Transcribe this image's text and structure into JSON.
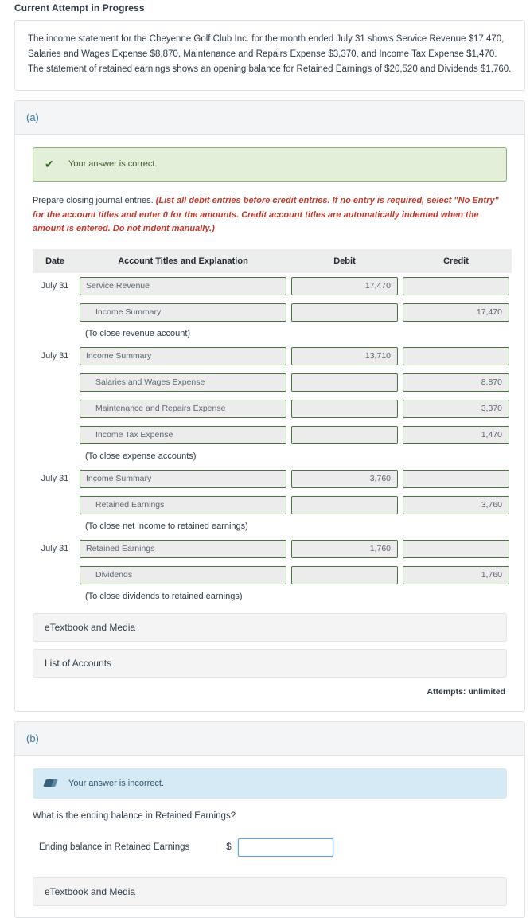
{
  "header": {
    "attempt_status": "Current Attempt in Progress"
  },
  "problem": {
    "statement": "The income statement for the Cheyenne Golf Club Inc. for the month ended July 31 shows Service Revenue $17,470, Salaries and Wages Expense $8,870, Maintenance and Repairs Expense $3,370, and Income Tax Expense $1,470. The statement of retained earnings shows an opening balance for Retained Earnings of $20,520 and Dividends $1,760."
  },
  "part_a": {
    "label": "(a)",
    "banner": {
      "icon": "check-icon",
      "text": "Your answer is correct."
    },
    "instruction_main": "Prepare closing journal entries.",
    "instruction_hint": "(List all debit entries before credit entries. If no entry is required, select \"No Entry\" for the account titles and enter 0 for the amounts. Credit account titles are automatically indented when the amount is entered. Do not indent manually.)",
    "table": {
      "columns": [
        "Date",
        "Account Titles and Explanation",
        "Debit",
        "Credit"
      ],
      "rows": [
        {
          "type": "entry",
          "date": "July 31",
          "account": "Service Revenue",
          "indent": false,
          "debit": "17,470",
          "credit": ""
        },
        {
          "type": "entry",
          "date": "",
          "account": "Income Summary",
          "indent": true,
          "debit": "",
          "credit": "17,470"
        },
        {
          "type": "memo",
          "text": "(To close revenue account)"
        },
        {
          "type": "entry",
          "date": "July 31",
          "account": "Income Summary",
          "indent": false,
          "debit": "13,710",
          "credit": ""
        },
        {
          "type": "entry",
          "date": "",
          "account": "Salaries and Wages Expense",
          "indent": true,
          "debit": "",
          "credit": "8,870"
        },
        {
          "type": "entry",
          "date": "",
          "account": "Maintenance and Repairs Expense",
          "indent": true,
          "debit": "",
          "credit": "3,370"
        },
        {
          "type": "entry",
          "date": "",
          "account": "Income Tax Expense",
          "indent": true,
          "debit": "",
          "credit": "1,470"
        },
        {
          "type": "memo",
          "text": "(To close expense accounts)"
        },
        {
          "type": "entry",
          "date": "July 31",
          "account": "Income Summary",
          "indent": false,
          "debit": "3,760",
          "credit": ""
        },
        {
          "type": "entry",
          "date": "",
          "account": "Retained Earnings",
          "indent": true,
          "debit": "",
          "credit": "3,760"
        },
        {
          "type": "memo",
          "text": "(To close net income to retained earnings)"
        },
        {
          "type": "entry",
          "date": "July 31",
          "account": "Retained Earnings",
          "indent": false,
          "debit": "1,760",
          "credit": ""
        },
        {
          "type": "entry",
          "date": "",
          "account": "Dividends",
          "indent": true,
          "debit": "",
          "credit": "1,760"
        },
        {
          "type": "memo",
          "text": "(To close dividends to retained earnings)"
        }
      ]
    },
    "etextbook_label": "eTextbook and Media",
    "list_of_accounts_label": "List of Accounts",
    "attempts": "Attempts: unlimited"
  },
  "part_b": {
    "label": "(b)",
    "banner": {
      "icon": "eraser-icon",
      "text": "Your answer is incorrect."
    },
    "question": "What is the ending balance in Retained Earnings?",
    "answer_label": "Ending balance in Retained Earnings",
    "currency_symbol": "$",
    "answer_value": "",
    "etextbook_label": "eTextbook and Media"
  },
  "colors": {
    "correct_banner_bg": "#e3efd9",
    "correct_banner_border": "#8cb372",
    "incorrect_banner_bg": "#d6eaf5",
    "field_border_green": "#4a7540",
    "field_bg": "#ececec",
    "part_label_blue": "#3e7ba8",
    "hint_red": "#c0392b",
    "active_input_blue": "#5ea3dd"
  }
}
